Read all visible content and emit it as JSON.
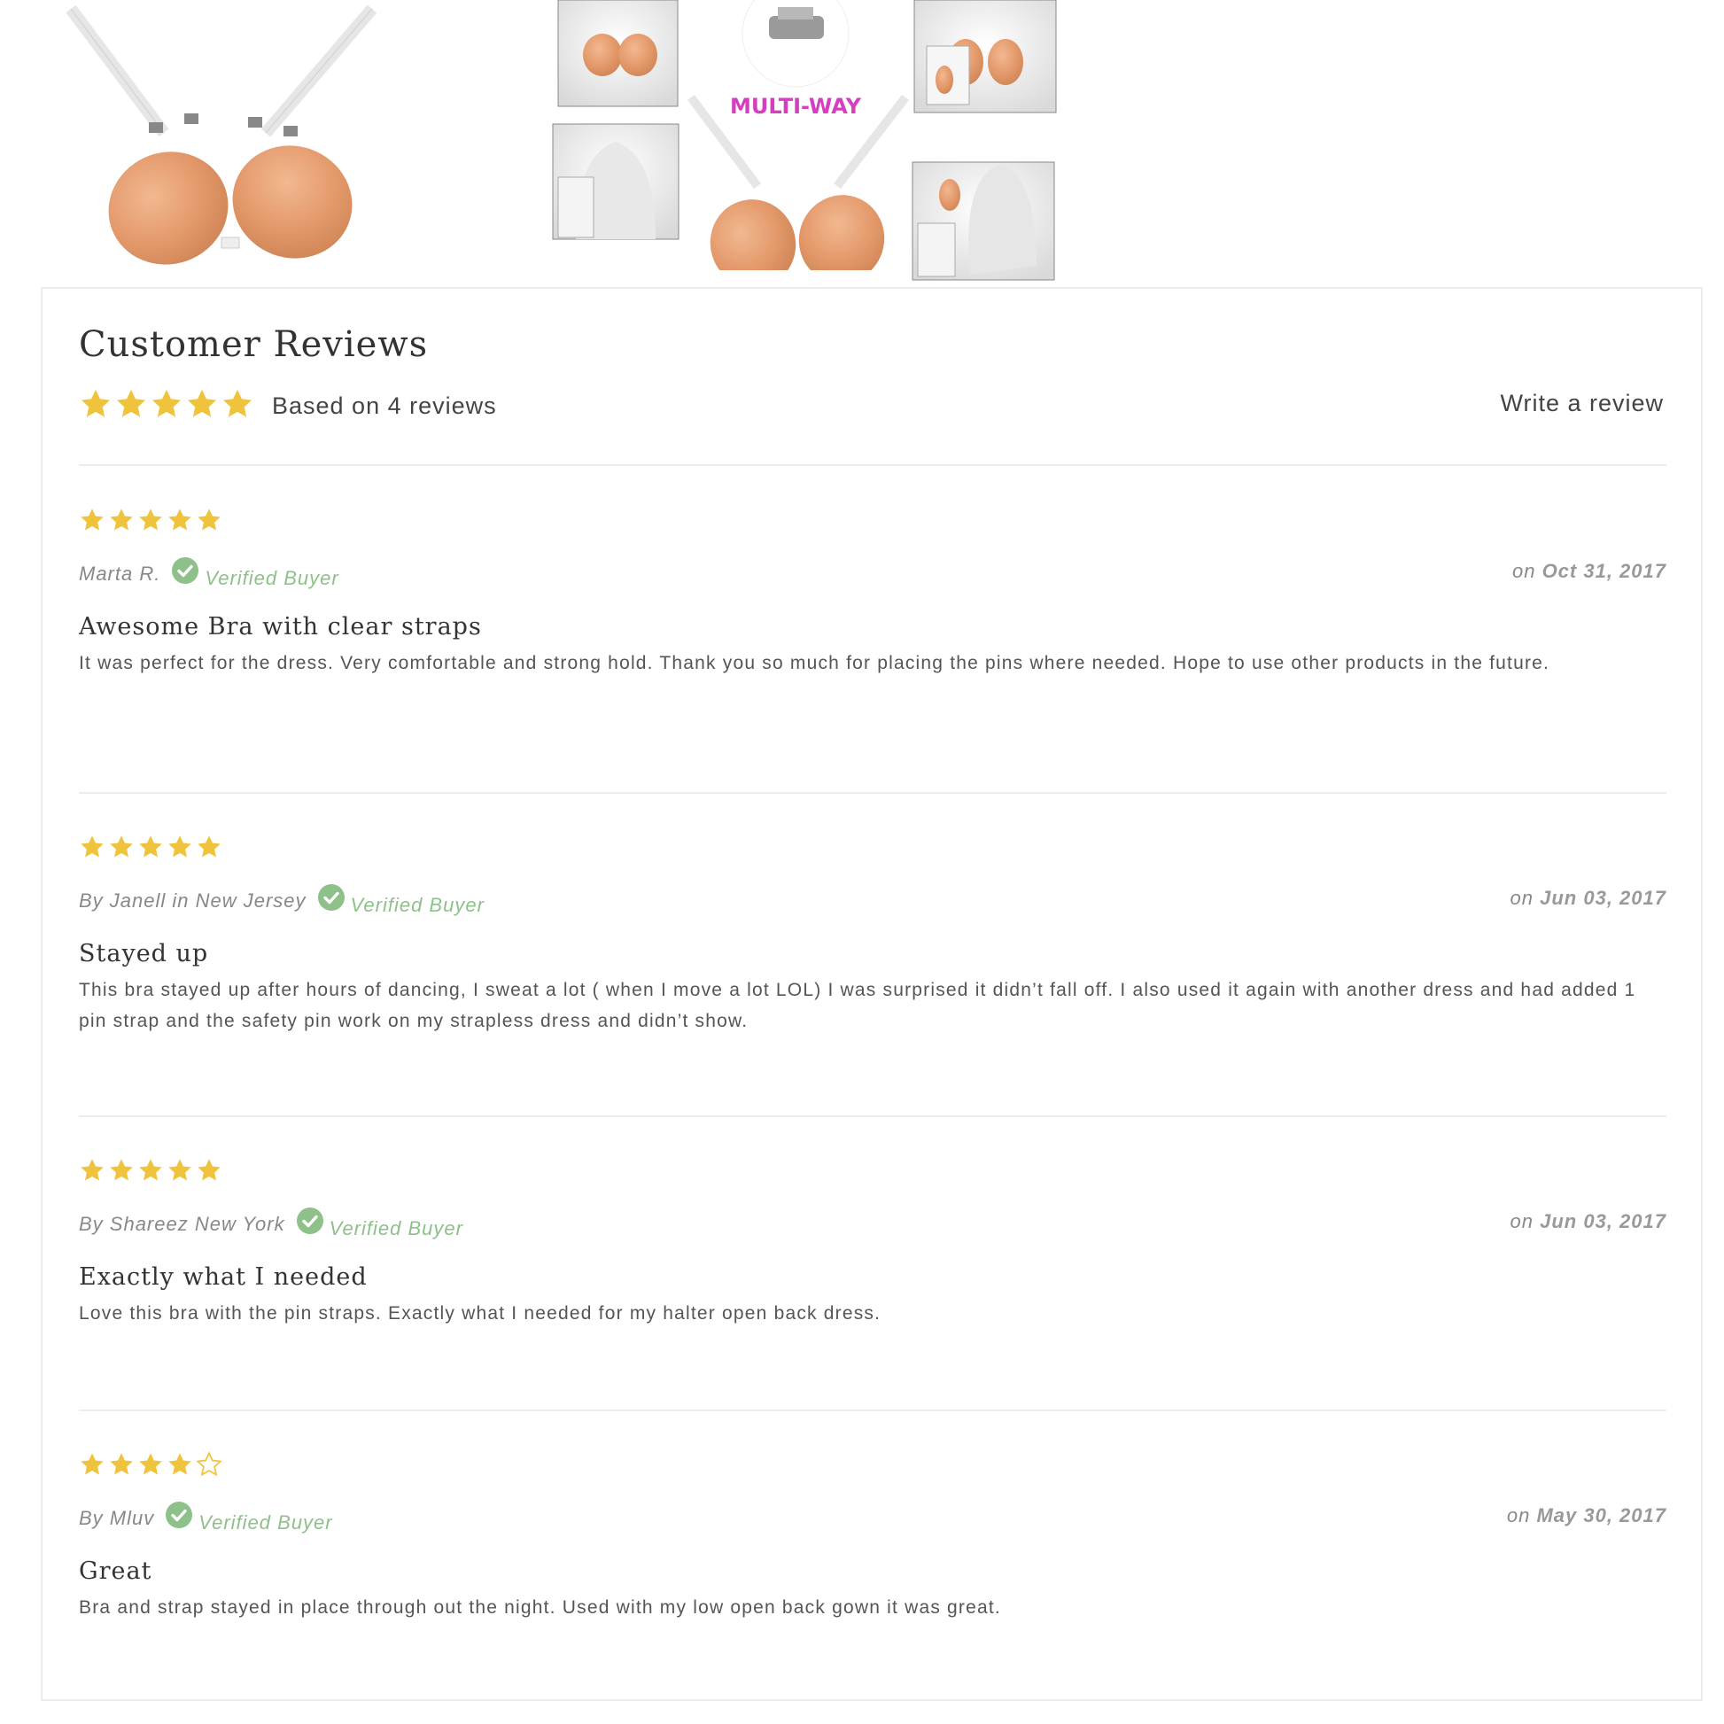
{
  "gallery": {
    "label": "MULTI-WAY"
  },
  "reviews": {
    "title": "Customer Reviews",
    "summary_rating": 5,
    "summary_text": "Based on 4 reviews",
    "write_review_label": "Write a review",
    "star_color": "#f0c33c",
    "verified_color": "#8ec08a",
    "items": [
      {
        "rating": 5,
        "author": "Marta R.",
        "verified": "Verified Buyer",
        "date_prefix": "on",
        "date": "Oct 31, 2017",
        "title": "Awesome Bra with clear straps",
        "body": "It was perfect for the dress. Very comfortable and strong hold. Thank you so much for placing the pins where needed. Hope to use other products in the future."
      },
      {
        "rating": 5,
        "author": "By Janell in New Jersey",
        "verified": "Verified Buyer",
        "date_prefix": "on",
        "date": "Jun 03, 2017",
        "title": "Stayed up",
        "body": "This bra stayed up after hours of dancing, I sweat a lot ( when I move a lot LOL) I was surprised it didn’t fall off. I also used it again with another dress and had added 1 pin strap and the safety pin work on my strapless dress and didn’t show."
      },
      {
        "rating": 5,
        "author": "By Shareez New York",
        "verified": "Verified Buyer",
        "date_prefix": "on",
        "date": "Jun 03, 2017",
        "title": "Exactly what I needed",
        "body": "Love this bra with the pin straps. Exactly what I needed for my halter open back dress."
      },
      {
        "rating": 4,
        "author": "By Mluv",
        "verified": "Verified Buyer",
        "date_prefix": "on",
        "date": "May 30, 2017",
        "title": "Great",
        "body": "Bra and strap stayed in place through out the night. Used with my low open back gown it was great."
      }
    ]
  }
}
